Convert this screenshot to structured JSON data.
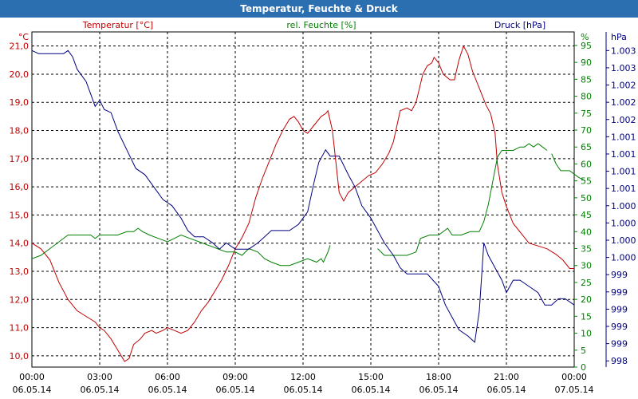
{
  "window": {
    "title": "Temperatur, Feuchte & Druck"
  },
  "colors": {
    "temperature": "#c00000",
    "humidity": "#008000",
    "pressure": "#000080",
    "grid": "#000000",
    "title_bar": "#2c6fb0"
  },
  "chart_data": {
    "type": "line",
    "grid": true,
    "axes": {
      "temperature": {
        "label": "Temperatur [°C]",
        "unit": "°C",
        "ticks": [
          "10,0",
          "11,0",
          "12,0",
          "13,0",
          "14,0",
          "15,0",
          "16,0",
          "17,0",
          "18,0",
          "19,0",
          "20,0",
          "21,0"
        ],
        "range": [
          9.6,
          21.5
        ]
      },
      "humidity": {
        "label": "rel. Feuchte [%]",
        "unit": "%",
        "ticks": [
          "0",
          "5",
          "10",
          "15",
          "20",
          "25",
          "30",
          "35",
          "40",
          "45",
          "50",
          "55",
          "60",
          "65",
          "70",
          "75",
          "80",
          "85",
          "90",
          "95"
        ],
        "range": [
          0,
          99
        ]
      },
      "pressure": {
        "label": "Druck [hPa]",
        "unit": "hPa",
        "ticks": [
          "998",
          "999",
          "999",
          "999",
          "999",
          "999",
          "1.000",
          "1.000",
          "1.000",
          "1.000",
          "1.001",
          "1.001",
          "1.001",
          "1.001",
          "1.002",
          "1.002",
          "1.002",
          "1.003",
          "1.003"
        ],
        "range": [
          997.9,
          1003.3
        ]
      }
    },
    "x_labels": [
      {
        "time": "00:00",
        "date": "06.05.14"
      },
      {
        "time": "03:00",
        "date": "06.05.14"
      },
      {
        "time": "06:00",
        "date": "06.05.14"
      },
      {
        "time": "09:00",
        "date": "06.05.14"
      },
      {
        "time": "12:00",
        "date": "06.05.14"
      },
      {
        "time": "15:00",
        "date": "06.05.14"
      },
      {
        "time": "18:00",
        "date": "06.05.14"
      },
      {
        "time": "21:00",
        "date": "06.05.14"
      },
      {
        "time": "00:00",
        "date": "07.05.14"
      }
    ],
    "series": [
      {
        "name": "Temperatur [°C]",
        "axis": "temperature",
        "color": "#c00000",
        "points": [
          [
            0,
            14.0
          ],
          [
            0.4,
            13.8
          ],
          [
            0.8,
            13.4
          ],
          [
            1.2,
            12.6
          ],
          [
            1.6,
            12.0
          ],
          [
            2.0,
            11.6
          ],
          [
            2.4,
            11.4
          ],
          [
            2.6,
            11.3
          ],
          [
            2.8,
            11.2
          ],
          [
            3.0,
            11.0
          ],
          [
            3.2,
            10.9
          ],
          [
            3.5,
            10.6
          ],
          [
            3.8,
            10.2
          ],
          [
            4.1,
            9.8
          ],
          [
            4.3,
            9.9
          ],
          [
            4.5,
            10.4
          ],
          [
            4.8,
            10.6
          ],
          [
            5.0,
            10.8
          ],
          [
            5.3,
            10.9
          ],
          [
            5.5,
            10.8
          ],
          [
            5.8,
            10.9
          ],
          [
            6.0,
            11.0
          ],
          [
            6.3,
            10.9
          ],
          [
            6.6,
            10.8
          ],
          [
            6.9,
            10.9
          ],
          [
            7.2,
            11.2
          ],
          [
            7.5,
            11.6
          ],
          [
            7.8,
            11.9
          ],
          [
            8.1,
            12.3
          ],
          [
            8.4,
            12.7
          ],
          [
            8.7,
            13.2
          ],
          [
            9.0,
            13.8
          ],
          [
            9.3,
            14.2
          ],
          [
            9.6,
            14.7
          ],
          [
            9.9,
            15.6
          ],
          [
            10.2,
            16.3
          ],
          [
            10.5,
            16.9
          ],
          [
            10.8,
            17.5
          ],
          [
            11.1,
            18.0
          ],
          [
            11.4,
            18.4
          ],
          [
            11.6,
            18.5
          ],
          [
            11.8,
            18.3
          ],
          [
            12.0,
            18.0
          ],
          [
            12.2,
            17.9
          ],
          [
            12.5,
            18.2
          ],
          [
            12.8,
            18.5
          ],
          [
            13.0,
            18.6
          ],
          [
            13.1,
            18.7
          ],
          [
            13.3,
            18.0
          ],
          [
            13.6,
            15.8
          ],
          [
            13.8,
            15.5
          ],
          [
            14.0,
            15.8
          ],
          [
            14.3,
            16.0
          ],
          [
            14.6,
            16.2
          ],
          [
            14.9,
            16.4
          ],
          [
            15.2,
            16.5
          ],
          [
            15.5,
            16.8
          ],
          [
            15.8,
            17.2
          ],
          [
            16.0,
            17.6
          ],
          [
            16.3,
            18.7
          ],
          [
            16.6,
            18.8
          ],
          [
            16.8,
            18.7
          ],
          [
            17.0,
            19.0
          ],
          [
            17.3,
            20.0
          ],
          [
            17.5,
            20.3
          ],
          [
            17.7,
            20.4
          ],
          [
            17.8,
            20.6
          ],
          [
            18.0,
            20.4
          ],
          [
            18.2,
            20.0
          ],
          [
            18.5,
            19.8
          ],
          [
            18.7,
            19.8
          ],
          [
            18.9,
            20.5
          ],
          [
            19.1,
            21.0
          ],
          [
            19.3,
            20.7
          ],
          [
            19.5,
            20.1
          ],
          [
            19.7,
            19.7
          ],
          [
            19.9,
            19.3
          ],
          [
            20.1,
            18.9
          ],
          [
            20.3,
            18.6
          ],
          [
            20.5,
            17.9
          ],
          [
            20.6,
            16.8
          ],
          [
            20.8,
            15.8
          ],
          [
            21.0,
            15.3
          ],
          [
            21.3,
            14.7
          ],
          [
            21.6,
            14.4
          ],
          [
            22.0,
            14.0
          ],
          [
            22.4,
            13.9
          ],
          [
            22.8,
            13.8
          ],
          [
            23.2,
            13.6
          ],
          [
            23.5,
            13.4
          ],
          [
            23.8,
            13.1
          ],
          [
            24.0,
            13.1
          ]
        ]
      },
      {
        "name": "rel. Feuchte [%]",
        "axis": "humidity",
        "color": "#008000",
        "points": [
          [
            0,
            32
          ],
          [
            0.4,
            33
          ],
          [
            0.8,
            35
          ],
          [
            1.2,
            37
          ],
          [
            1.6,
            39
          ],
          [
            2.0,
            39
          ],
          [
            2.4,
            39
          ],
          [
            2.6,
            39
          ],
          [
            2.8,
            38
          ],
          [
            3.0,
            39
          ],
          [
            3.4,
            39
          ],
          [
            3.8,
            39
          ],
          [
            4.2,
            40
          ],
          [
            4.5,
            40
          ],
          [
            4.7,
            41
          ],
          [
            4.9,
            40
          ],
          [
            5.2,
            39
          ],
          [
            5.6,
            38
          ],
          [
            6.0,
            37
          ],
          [
            6.3,
            38
          ],
          [
            6.6,
            39
          ],
          [
            7.0,
            38
          ],
          [
            7.4,
            37
          ],
          [
            7.8,
            36
          ],
          [
            8.2,
            35
          ],
          [
            8.6,
            34
          ],
          [
            9.0,
            34
          ],
          [
            9.3,
            33
          ],
          [
            9.6,
            35
          ],
          [
            10.0,
            34
          ],
          [
            10.3,
            32
          ],
          [
            10.6,
            31
          ],
          [
            11.0,
            30
          ],
          [
            11.4,
            30
          ],
          [
            11.8,
            31
          ],
          [
            12.2,
            32
          ],
          [
            12.6,
            31
          ],
          [
            12.8,
            32
          ],
          [
            12.9,
            31
          ],
          [
            13.1,
            34
          ],
          [
            13.2,
            36
          ]
        ]
      },
      {
        "name": "rel. Feuchte [%]",
        "axis": "humidity",
        "color": "#008000",
        "points": [
          [
            15.3,
            35
          ],
          [
            15.6,
            33
          ],
          [
            16.0,
            33
          ],
          [
            16.3,
            33
          ],
          [
            16.6,
            33
          ],
          [
            17.0,
            34
          ],
          [
            17.2,
            38
          ],
          [
            17.6,
            39
          ],
          [
            18.0,
            39
          ],
          [
            18.4,
            41
          ],
          [
            18.6,
            39
          ],
          [
            19.0,
            39
          ],
          [
            19.4,
            40
          ],
          [
            19.8,
            40
          ],
          [
            20.0,
            43
          ],
          [
            20.2,
            48
          ],
          [
            20.4,
            55
          ],
          [
            20.6,
            62
          ],
          [
            20.8,
            64
          ],
          [
            21.0,
            64
          ],
          [
            21.3,
            64
          ],
          [
            21.6,
            65
          ],
          [
            21.8,
            65
          ],
          [
            22.0,
            66
          ],
          [
            22.2,
            65
          ],
          [
            22.4,
            66
          ],
          [
            22.6,
            65
          ],
          [
            22.8,
            64
          ]
        ]
      },
      {
        "name": "rel. Feuchte [%]",
        "axis": "humidity",
        "color": "#008000",
        "points": [
          [
            23.0,
            63
          ],
          [
            23.2,
            60
          ],
          [
            23.4,
            58
          ],
          [
            23.8,
            58
          ],
          [
            24.0,
            57
          ],
          [
            24.2,
            56
          ],
          [
            24.5,
            55
          ]
        ]
      },
      {
        "name": "Druck [hPa]",
        "axis": "pressure",
        "color": "#000080",
        "points": [
          [
            0,
            1003.0
          ],
          [
            0.3,
            1002.95
          ],
          [
            1.0,
            1002.95
          ],
          [
            1.4,
            1002.95
          ],
          [
            1.6,
            1003.0
          ],
          [
            1.8,
            1002.9
          ],
          [
            2.0,
            1002.7
          ],
          [
            2.4,
            1002.5
          ],
          [
            2.6,
            1002.3
          ],
          [
            2.8,
            1002.1
          ],
          [
            3.0,
            1002.2
          ],
          [
            3.2,
            1002.05
          ],
          [
            3.5,
            1002.0
          ],
          [
            3.8,
            1001.7
          ],
          [
            4.2,
            1001.4
          ],
          [
            4.6,
            1001.1
          ],
          [
            5.0,
            1001.0
          ],
          [
            5.4,
            1000.8
          ],
          [
            5.8,
            1000.6
          ],
          [
            6.2,
            1000.5
          ],
          [
            6.6,
            1000.3
          ],
          [
            6.9,
            1000.1
          ],
          [
            7.2,
            1000.0
          ],
          [
            7.6,
            1000.0
          ],
          [
            8.0,
            999.9
          ],
          [
            8.3,
            999.8
          ],
          [
            8.6,
            999.9
          ],
          [
            9.0,
            999.8
          ],
          [
            9.3,
            999.8
          ],
          [
            9.6,
            999.8
          ],
          [
            10.0,
            999.9
          ],
          [
            10.3,
            1000.0
          ],
          [
            10.6,
            1000.1
          ],
          [
            11.0,
            1000.1
          ],
          [
            11.4,
            1000.1
          ],
          [
            11.8,
            1000.2
          ],
          [
            12.0,
            1000.3
          ],
          [
            12.2,
            1000.4
          ],
          [
            12.5,
            1000.9
          ],
          [
            12.7,
            1001.2
          ],
          [
            13.0,
            1001.4
          ],
          [
            13.2,
            1001.3
          ],
          [
            13.6,
            1001.3
          ],
          [
            14.0,
            1001.0
          ],
          [
            14.3,
            1000.8
          ],
          [
            14.6,
            1000.5
          ],
          [
            15.0,
            1000.3
          ],
          [
            15.3,
            1000.1
          ],
          [
            15.6,
            999.9
          ],
          [
            16.0,
            999.7
          ],
          [
            16.3,
            999.5
          ],
          [
            16.6,
            999.4
          ],
          [
            17.0,
            999.4
          ],
          [
            17.5,
            999.4
          ],
          [
            18.0,
            999.2
          ],
          [
            18.3,
            998.9
          ],
          [
            18.6,
            998.7
          ],
          [
            18.9,
            998.5
          ],
          [
            19.3,
            998.4
          ],
          [
            19.6,
            998.3
          ],
          [
            19.8,
            998.8
          ],
          [
            20.0,
            999.9
          ],
          [
            20.2,
            999.7
          ],
          [
            20.5,
            999.5
          ],
          [
            20.8,
            999.3
          ],
          [
            21.0,
            999.1
          ],
          [
            21.3,
            999.3
          ],
          [
            21.6,
            999.3
          ],
          [
            22.0,
            999.2
          ],
          [
            22.4,
            999.1
          ],
          [
            22.7,
            998.9
          ],
          [
            23.0,
            998.9
          ],
          [
            23.3,
            999.0
          ],
          [
            23.6,
            999.0
          ],
          [
            24.0,
            998.9
          ]
        ]
      }
    ]
  }
}
